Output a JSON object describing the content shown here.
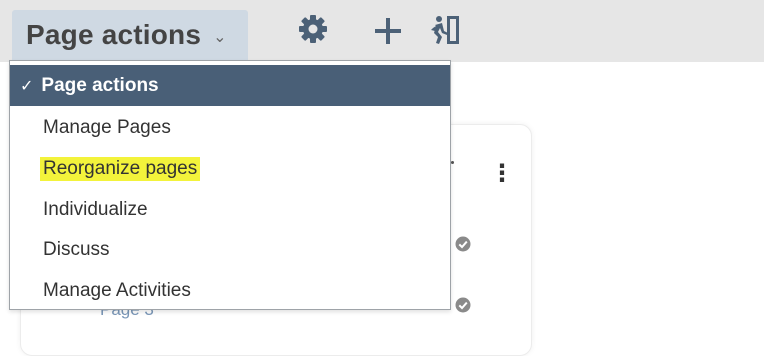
{
  "toolbar": {
    "select_label": "Page actions",
    "caret": "⌄",
    "icons": [
      "gear-icon",
      "plus-icon",
      "exit-icon"
    ]
  },
  "menu": {
    "selected_label": "Page actions",
    "items": [
      {
        "label": "Manage Pages"
      },
      {
        "label": "Reorganize pages",
        "highlighted": true
      },
      {
        "label": "Individualize"
      },
      {
        "label": "Discuss"
      },
      {
        "label": "Manage Activities"
      }
    ]
  },
  "background": {
    "kebab": "⋮",
    "partial_link": "Page 3"
  },
  "colors": {
    "topbar_bg": "#e6e6e6",
    "select_bg": "#cfd9e3",
    "menu_selected_bg": "#495f77",
    "highlight": "#f3f33b",
    "icon_color": "#4c6177"
  }
}
